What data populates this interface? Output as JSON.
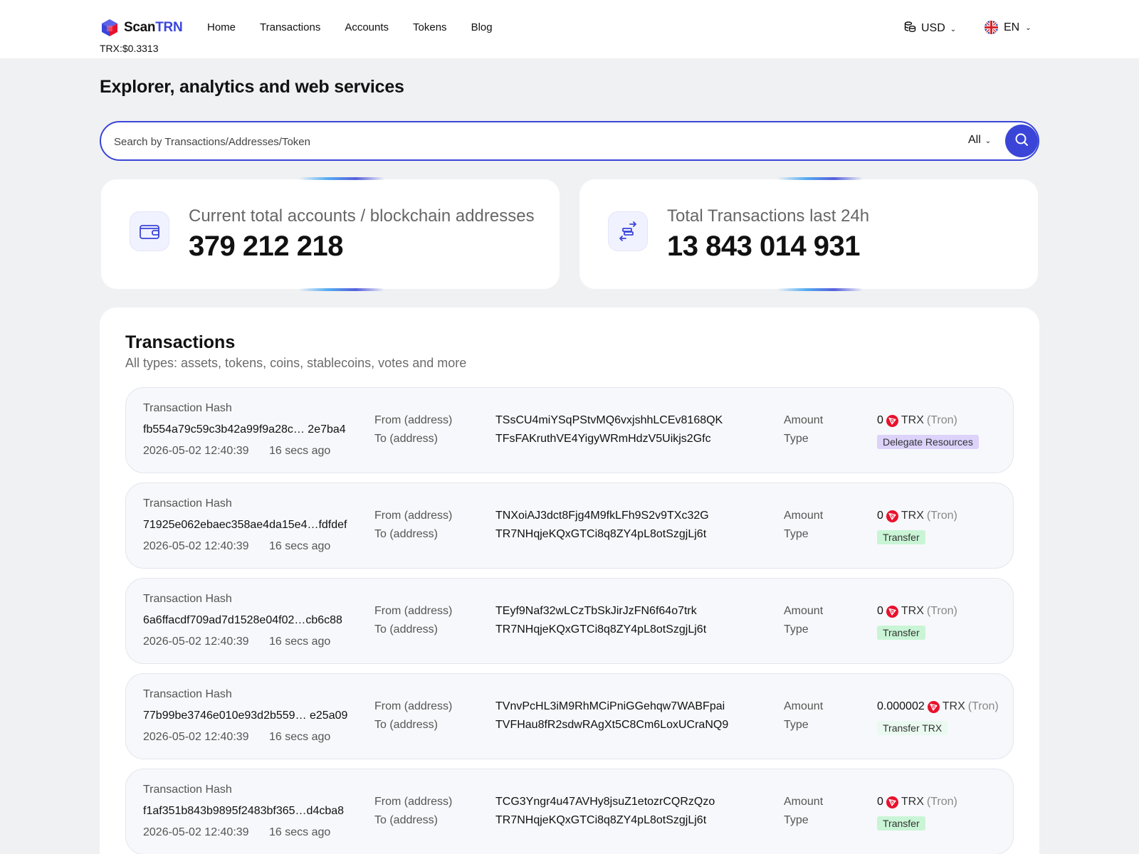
{
  "header": {
    "logo": {
      "prefix": "Scan",
      "accent": "TRN"
    },
    "trx_price": "TRX:$0.3313",
    "nav": [
      "Home",
      "Transactions",
      "Accounts",
      "Tokens",
      "Blog"
    ],
    "currency": "USD",
    "language": "EN"
  },
  "page_title": "Explorer, analytics and web services",
  "search": {
    "placeholder": "Search by Transactions/Addresses/Token",
    "filter": "All"
  },
  "stats": {
    "accounts": {
      "label": "Current total accounts / blockchain addresses",
      "value": "379 212 218"
    },
    "transactions": {
      "label": "Total Transactions last 24h",
      "value": "13 843 014 931"
    }
  },
  "transactions": {
    "title": "Transactions",
    "subtitle": "All types: assets, tokens, coins, stablecoins, votes and more",
    "labels": {
      "hash": "Transaction Hash",
      "from": "From (address)",
      "to": "To (address)",
      "amount": "Amount",
      "type": "Type"
    },
    "rows": [
      {
        "hash": "fb554a79c59c3b42a99f9a28c… 2e7ba4",
        "date": "2026-05-02 12:40:39",
        "ago": "16 secs ago",
        "from": "TSsCU4miYSqPStvMQ6vxjshhLCEv8168QK",
        "to": "TFsFAKruthVE4YigyWRmHdzV5Uikjs2Gfc",
        "amount": "0",
        "currency": "TRX",
        "network": "(Tron)",
        "type": "Delegate Resources",
        "type_color": "#dcd2fa"
      },
      {
        "hash": "71925e062ebaec358ae4da15e4…fdfdef",
        "date": "2026-05-02 12:40:39",
        "ago": "16 secs ago",
        "from": "TNXoiAJ3dct8Fjg4M9fkLFh9S2v9TXc32G",
        "to": "TR7NHqjeKQxGTCi8q8ZY4pL8otSzgjLj6t",
        "amount": "0",
        "currency": "TRX",
        "network": "(Tron)",
        "type": "Transfer",
        "type_color": "#c9f5d6"
      },
      {
        "hash": "6a6ffacdf709ad7d1528e04f02…cb6c88",
        "date": "2026-05-02 12:40:39",
        "ago": "16 secs ago",
        "from": "TEyf9Naf32wLCzTbSkJirJzFN6f64o7trk",
        "to": "TR7NHqjeKQxGTCi8q8ZY4pL8otSzgjLj6t",
        "amount": "0",
        "currency": "TRX",
        "network": "(Tron)",
        "type": "Transfer",
        "type_color": "#c9f5d6"
      },
      {
        "hash": "77b99be3746e010e93d2b559… e25a09",
        "date": "2026-05-02 12:40:39",
        "ago": "16 secs ago",
        "from": "TVnvPcHL3iM9RhMCiPniGGehqw7WABFpai",
        "to": "TVFHau8fR2sdwRAgXt5C8Cm6LoxUCraNQ9",
        "amount": "0.000002",
        "currency": "TRX",
        "network": "(Tron)",
        "type": "Transfer TRX",
        "type_color": "#eafaf0"
      },
      {
        "hash": "f1af351b843b9895f2483bf365…d4cba8",
        "date": "2026-05-02 12:40:39",
        "ago": "16 secs ago",
        "from": "TCG3Yngr4u47AVHy8jsuZ1etozrCQRzQzo",
        "to": "TR7NHqjeKQxGTCi8q8ZY4pL8otSzgjLj6t",
        "amount": "0",
        "currency": "TRX",
        "network": "(Tron)",
        "type": "Transfer",
        "type_color": "#c9f5d6"
      }
    ]
  }
}
